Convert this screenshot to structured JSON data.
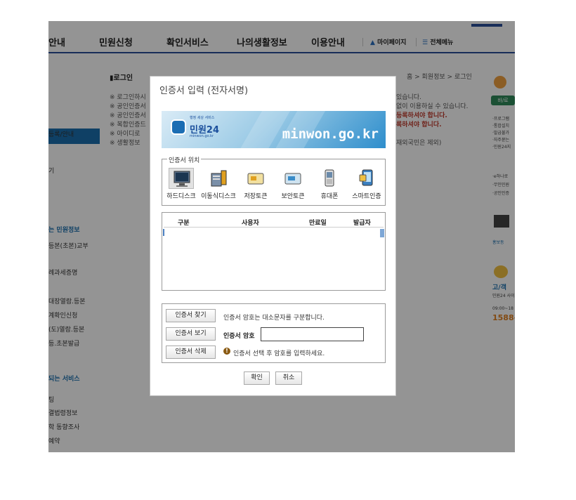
{
  "nav": {
    "items": [
      "안내",
      "민원신청",
      "확인서비스",
      "나의생활정보",
      "이용안내"
    ],
    "mypage": "마이페이지",
    "allmenu": "전체메뉴"
  },
  "page": {
    "title": "로그인",
    "breadcrumb": "홈 > 회원정보 > 로그인",
    "bullets": [
      "※ 로그인하시",
      "※ 공인인증서",
      "※ 공인인증서",
      "※ 복합인증드",
      "※ 아이디로",
      "※ 생활정보"
    ],
    "right_texts": [
      "있습니다.",
      "없이 이용하실 수 있습니다.",
      "등록하셔야 합니다.",
      "록하셔야 합니다.",
      "재외국민은 제외)"
    ]
  },
  "sidebar": {
    "items": [
      "등록/안내",
      "기"
    ],
    "section1": "는 민원정보",
    "section1_items": [
      "등본(초본)교부",
      "례과세증명",
      "대장열람.등본",
      "계확인신청",
      "(도)열람.등본",
      "등.초본발급"
    ],
    "section2": "되는 서비스",
    "section2_items": [
      "팅",
      "결법령정보",
      "학 동향조사",
      "예약"
    ]
  },
  "rightbar": {
    "items": [
      "바/로",
      "·프로그램",
      "·통합설치",
      "·발급불가",
      "·자주묻는",
      "·민원24지",
      "·e하나로",
      "·무인민원",
      "·공인인증",
      "홍보동",
      "고/객",
      "민원24 사이",
      "09:00~18",
      "1588-"
    ]
  },
  "dialog": {
    "title": "인증서 입력 (전자서명)",
    "banner": {
      "logo_sub": "행정 세상 서비스",
      "logo_text": "민원24",
      "logo_domain": "minwon.go.kr",
      "domain": "minwon.go.kr"
    },
    "location": {
      "legend": "인증서 위치",
      "items": [
        {
          "label": "하드디스크",
          "icon": "hard-disk-icon",
          "selected": true
        },
        {
          "label": "이동식디스크",
          "icon": "removable-disk-icon",
          "selected": false
        },
        {
          "label": "저장토큰",
          "icon": "storage-token-icon",
          "selected": false
        },
        {
          "label": "보안토큰",
          "icon": "security-token-icon",
          "selected": false
        },
        {
          "label": "휴대폰",
          "icon": "mobile-phone-icon",
          "selected": false
        },
        {
          "label": "스마트인증",
          "icon": "smart-auth-icon",
          "selected": false
        }
      ]
    },
    "table": {
      "columns": [
        "구분",
        "사용자",
        "만료일",
        "발급자"
      ],
      "rows": []
    },
    "actions": {
      "find": "인증서 찾기",
      "view": "인증서 보기",
      "delete": "인증서 삭제",
      "hint_case": "인증서 암호는 대소문자를 구분합니다.",
      "password_label": "인증서 암호",
      "password_value": "",
      "hint_select": "인증서 선택 후 암호를 입력하세요."
    },
    "confirm": "확인",
    "cancel": "취소"
  },
  "colors": {
    "nav_border": "#2a4f9a",
    "sidebar_active": "#1a6fae",
    "dim": "rgba(0,0,0,0.42)"
  }
}
